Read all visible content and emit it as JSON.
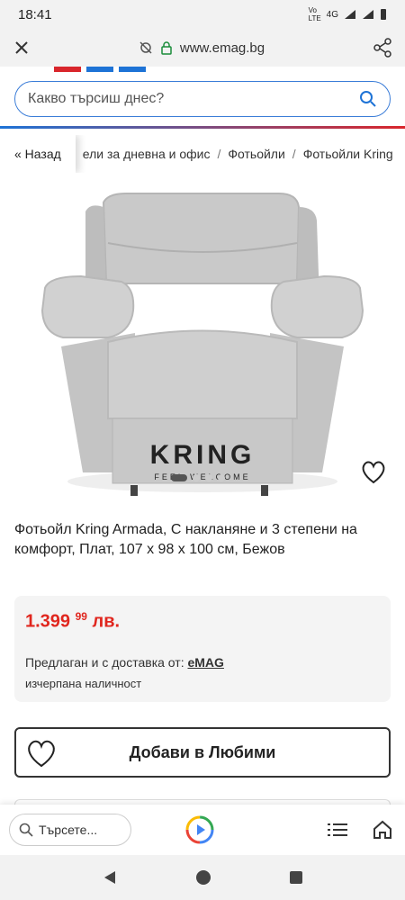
{
  "status_bar": {
    "time": "18:41",
    "signal_small": "Vo LTE",
    "network": "4G"
  },
  "browser": {
    "url": "www.emag.bg"
  },
  "search": {
    "placeholder": "Какво търсиш днес?"
  },
  "breadcrumb": {
    "back_label": "« Назад",
    "items": [
      "ели за дневна и офис",
      "Фотьойли",
      "Фотьойли Kring"
    ]
  },
  "product": {
    "brand_logo": "KRING",
    "brand_tagline": "FEEL WELCOME",
    "title": "Фотьойл Kring Armada, С накланяне и 3 степени на комфорт, Плат, 107 x 98 x 100 см, Бежов",
    "price_main": "1.399",
    "price_cents": "99",
    "price_currency": "лв.",
    "seller_prefix": "Предлаган и с доставка от:",
    "seller_name": "eMAG",
    "stock": "изчерпана наличност",
    "add_fav_label": "Добави в Любими",
    "image_count": 4,
    "active_image": 1
  },
  "bottom_toolbar": {
    "search_label": "Търсете..."
  },
  "colors": {
    "accent_blue": "#1e73d6",
    "price_red": "#e0261e",
    "brand_red": "#d9262c"
  }
}
